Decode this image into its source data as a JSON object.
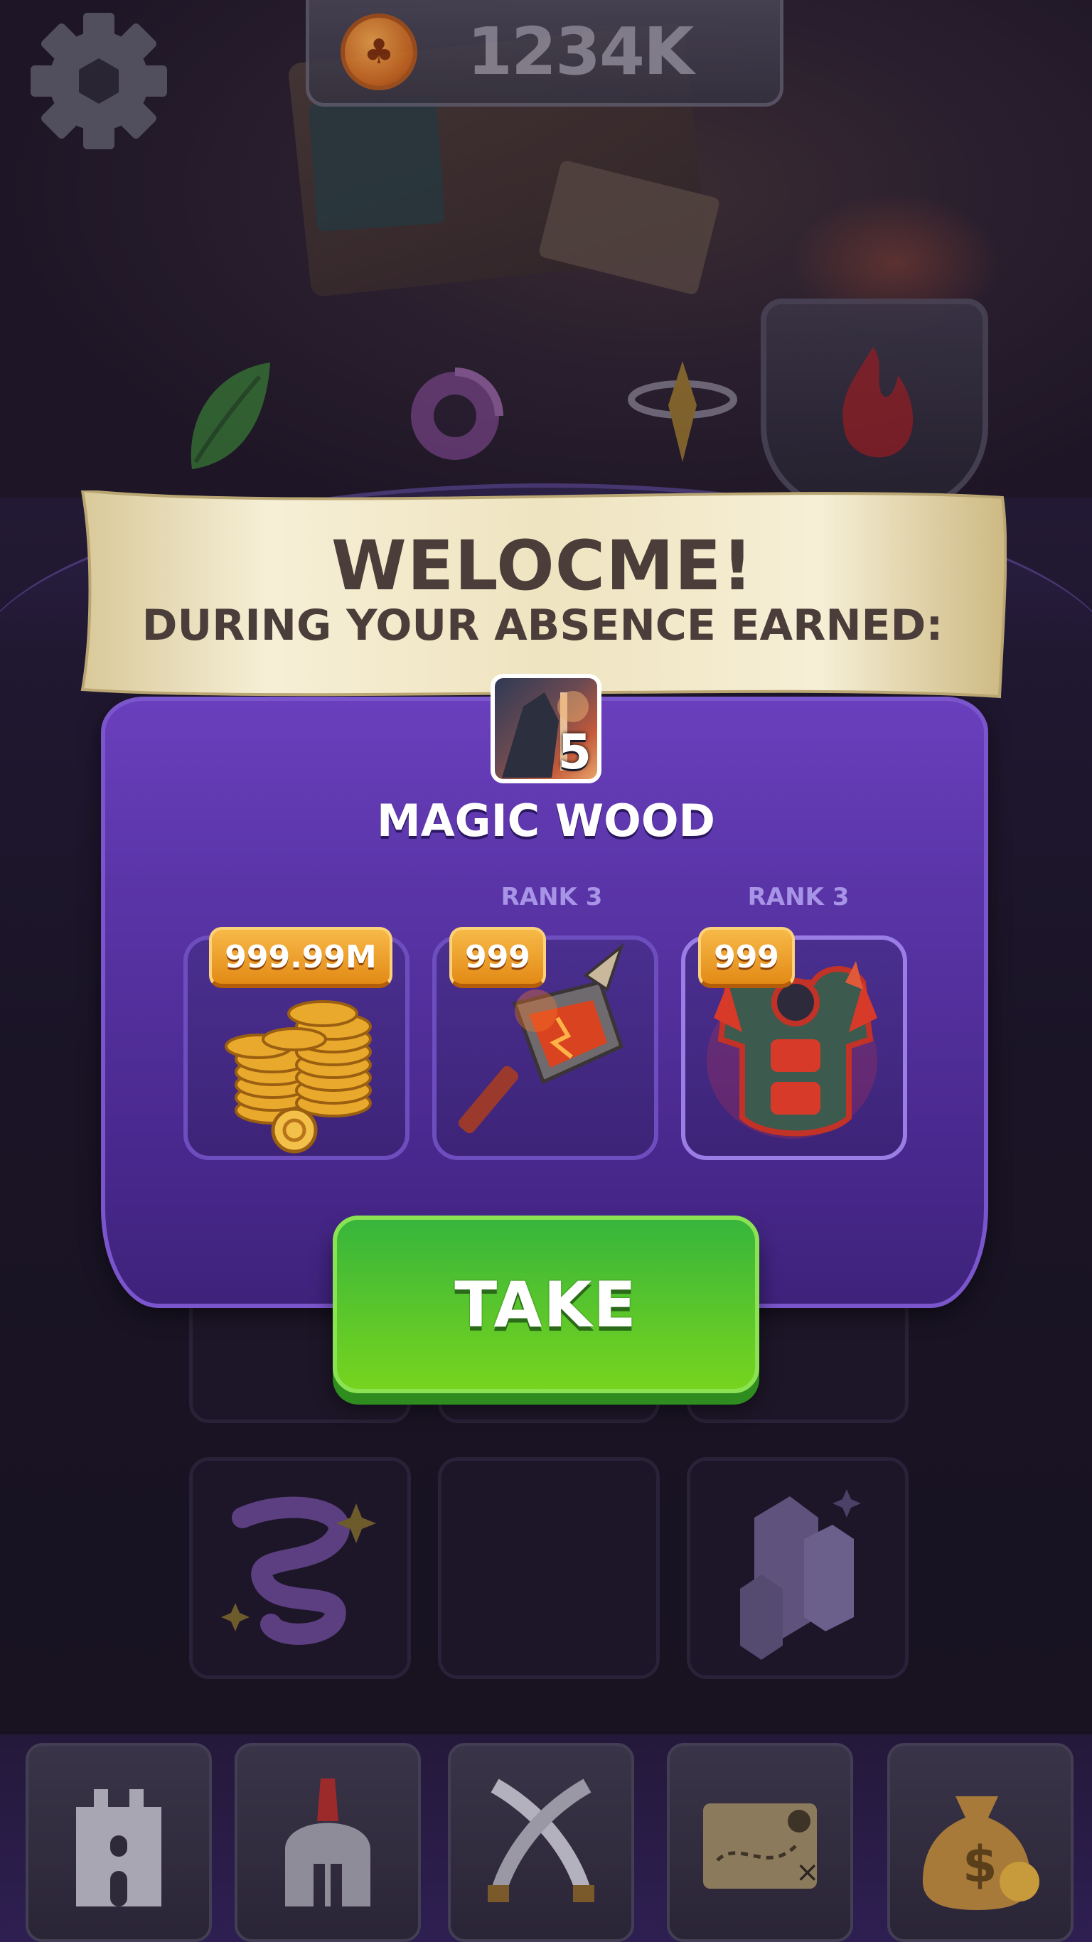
{
  "top_bar": {
    "currency_value": "1234K",
    "settings_icon": "gear-icon",
    "currency_icon": "coin-icon"
  },
  "popup": {
    "title": "WELOCME!",
    "subtitle": "DURING YOUR ABSENCE EARNED:",
    "location": {
      "name": "MAGIC WOOD",
      "level": "5"
    },
    "rewards": [
      {
        "name": "gold-coins",
        "quantity": "999.99M",
        "rank": ""
      },
      {
        "name": "fire-hammer",
        "quantity": "999",
        "rank": "RANK 3"
      },
      {
        "name": "dragon-armor",
        "quantity": "999",
        "rank": "RANK 3"
      }
    ],
    "take_label": "TAKE"
  },
  "bottom_nav": {
    "items": [
      "castle-icon",
      "spartan-helmet-icon",
      "crossed-swords-icon",
      "treasure-map-icon",
      "money-bag-icon"
    ]
  },
  "colors": {
    "panel": "#5a35a8",
    "banner": "#efe6c6",
    "badge": "#f0a23a",
    "take_button": "#5ec82a"
  }
}
